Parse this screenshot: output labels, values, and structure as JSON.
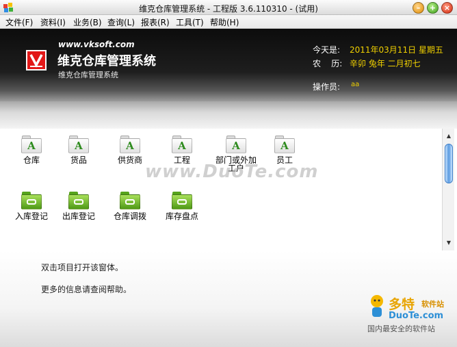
{
  "window": {
    "title": "维克仓库管理系统 - 工程版 3.6.110310 - (试用)"
  },
  "menu": [
    {
      "label": "文件(F)"
    },
    {
      "label": "资料(I)"
    },
    {
      "label": "业务(B)"
    },
    {
      "label": "查询(L)"
    },
    {
      "label": "报表(R)"
    },
    {
      "label": "工具(T)"
    },
    {
      "label": "帮助(H)"
    }
  ],
  "header": {
    "logo_letter": "V",
    "site": "www.vksoft.com",
    "title": "维克仓库管理系统",
    "subtitle": "维克仓库管理系统",
    "today_label": "今天是:",
    "today_value": "2011年03月11日  星期五",
    "lunar_label": "农    历:",
    "lunar_value": "辛卯  兔年  二月初七",
    "operator_label": "操作员:",
    "operator_value": "aa"
  },
  "modules_row1": [
    {
      "label": "仓库",
      "icon": "folder-a-icon"
    },
    {
      "label": "货品",
      "icon": "folder-a-icon"
    },
    {
      "label": "供货商",
      "icon": "folder-a-icon"
    },
    {
      "label": "工程",
      "icon": "folder-a-icon"
    },
    {
      "label": "部门或外加工户",
      "icon": "folder-a-icon"
    },
    {
      "label": "员工",
      "icon": "folder-a-icon"
    }
  ],
  "modules_row2": [
    {
      "label": "入库登记",
      "icon": "folder-green-icon"
    },
    {
      "label": "出库登记",
      "icon": "folder-green-icon"
    },
    {
      "label": "仓库调拨",
      "icon": "folder-green-icon"
    },
    {
      "label": "库存盘点",
      "icon": "folder-green-icon"
    }
  ],
  "help": {
    "line1": "双击项目打开该窗体。",
    "line2": "更多的信息请查阅帮助。"
  },
  "watermark": {
    "center": "www.DuoTe.com",
    "brand": "多特",
    "brand_sub": "软件站",
    "site": "DuoTe.com",
    "tagline": "国内最安全的软件站"
  },
  "colors": {
    "accent_yellow": "#f0d000",
    "logo_red": "#e21818",
    "folder_green": "#4f9a16"
  }
}
